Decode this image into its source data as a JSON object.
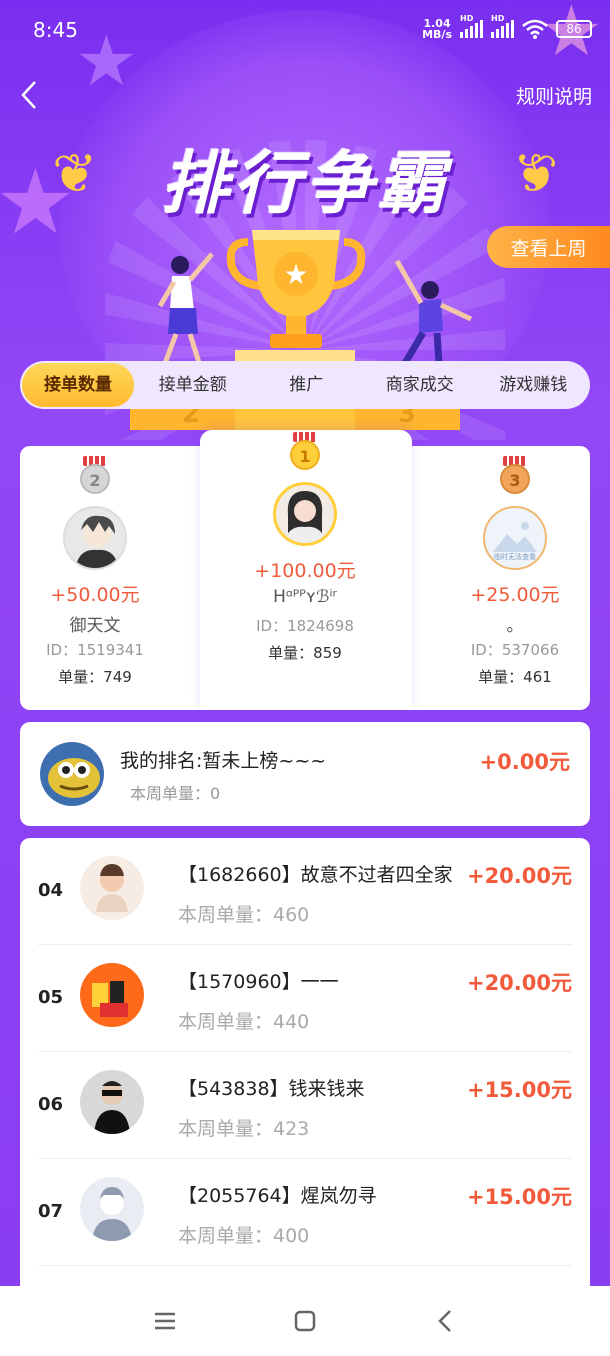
{
  "status_bar": {
    "time": "8:45",
    "net_speed_value": "1.04",
    "net_speed_unit": "MB/s",
    "signal1_label": "HD",
    "signal2_label": "HD",
    "battery": "86"
  },
  "header": {
    "title": "排行争霸",
    "rules_label": "规则说明",
    "last_week_label": "查看上周"
  },
  "tabs": [
    {
      "label": "接单数量",
      "active": true
    },
    {
      "label": "接单金额",
      "active": false
    },
    {
      "label": "推广",
      "active": false
    },
    {
      "label": "商家成交",
      "active": false
    },
    {
      "label": "游戏赚钱",
      "active": false
    }
  ],
  "podium_numbers": [
    "2",
    "1",
    "3"
  ],
  "top3": [
    {
      "rank": "2",
      "amount": "+50.00元",
      "name": "御天文",
      "id": "ID：1519341",
      "orders": "单量：749"
    },
    {
      "rank": "1",
      "amount": "+100.00元",
      "name": "Hᵅᴾᴾʏℬⁱʳ",
      "id": "ID：1824698",
      "orders": "单量：859"
    },
    {
      "rank": "3",
      "amount": "+25.00元",
      "name": "。",
      "id": "ID：537066",
      "orders": "单量：461",
      "avatar_caption": "临时无法查看"
    }
  ],
  "my_rank": {
    "title": "我的排名:暂未上榜~~~",
    "sub": "本周单量：0",
    "amount": "+0.00元"
  },
  "list": [
    {
      "rank": "04",
      "name": "【1682660】故意不过者四全家",
      "sub": "本周单量：460",
      "amount": "+20.00元"
    },
    {
      "rank": "05",
      "name": "【1570960】一一",
      "sub": "本周单量：440",
      "amount": "+20.00元"
    },
    {
      "rank": "06",
      "name": "【543838】钱来钱来",
      "sub": "本周单量：423",
      "amount": "+15.00元"
    },
    {
      "rank": "07",
      "name": "【2055764】煋岚勿寻",
      "sub": "本周单量：400",
      "amount": "+15.00元"
    }
  ],
  "colors": {
    "accent": "#f25a3c",
    "purple": "#8a3df0",
    "gold": "#ffb92e"
  }
}
